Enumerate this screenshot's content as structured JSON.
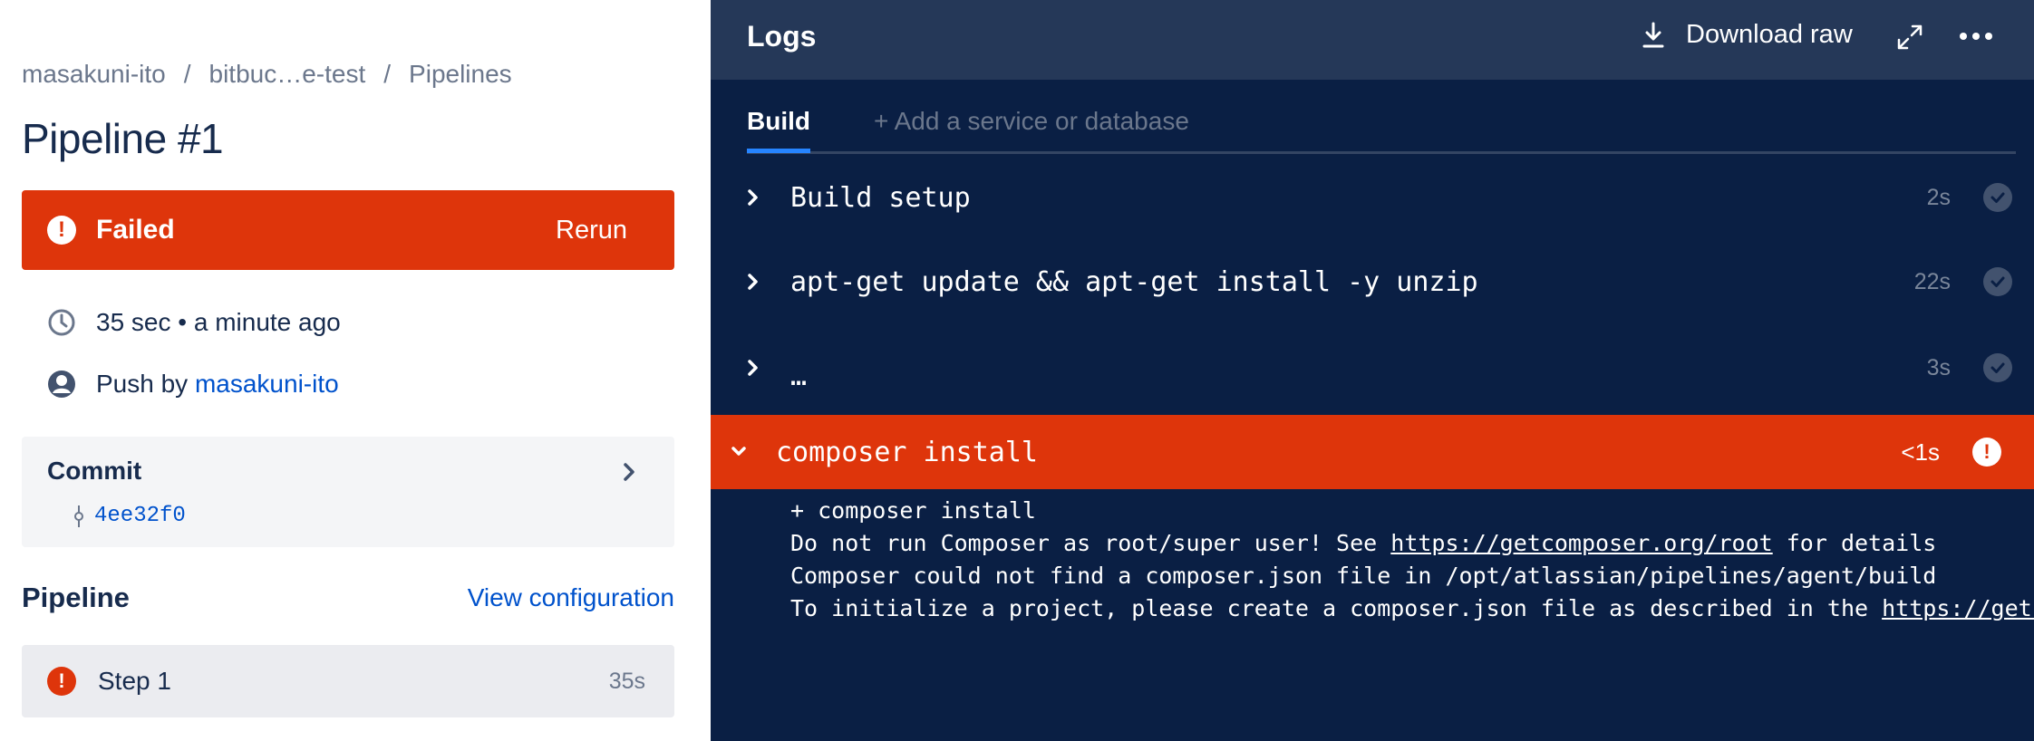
{
  "breadcrumb": [
    "masakuni-ito",
    "bitbuc…e-test",
    "Pipelines"
  ],
  "page_title": "Pipeline #1",
  "status": {
    "label": "Failed",
    "rerun_label": "Rerun",
    "color": "#de350b"
  },
  "meta": {
    "duration": "35 sec • a minute ago",
    "push_prefix": "Push by ",
    "push_user": "masakuni-ito"
  },
  "commit": {
    "title": "Commit",
    "hash": "4ee32f0"
  },
  "pipeline": {
    "heading": "Pipeline",
    "view_config": "View configuration",
    "steps": [
      {
        "label": "Step 1",
        "duration": "35s",
        "status": "failed"
      }
    ]
  },
  "logs": {
    "title": "Logs",
    "download_label": "Download raw",
    "tabs": {
      "build": "Build",
      "add": "+ Add a service or database"
    },
    "steps": [
      {
        "name": "Build setup",
        "duration": "2s",
        "status": "success"
      },
      {
        "name": "apt-get update && apt-get install -y unzip",
        "duration": "22s",
        "status": "success"
      },
      {
        "name": "…",
        "duration": "3s",
        "status": "success"
      },
      {
        "name": "composer install",
        "duration": "<1s",
        "status": "failed"
      }
    ],
    "output": {
      "line1": "+ composer install",
      "line2_pre": "Do not run Composer as root/super user! See ",
      "line2_link": "https://getcomposer.org/root",
      "line2_post": " for details",
      "line3": "Composer could not find a composer.json file in /opt/atlassian/pipelines/agent/build",
      "line4_pre": "To initialize a project, please create a composer.json file as described in the ",
      "line4_link": "https://getcompo"
    }
  },
  "colors": {
    "accent": "#0052cc",
    "failed": "#de350b",
    "logs_bg": "#0a1f44",
    "logs_header": "#253858"
  }
}
